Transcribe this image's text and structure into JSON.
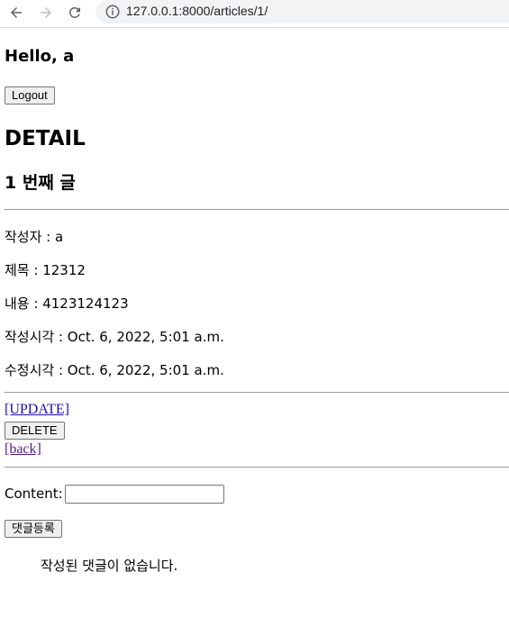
{
  "browser": {
    "url": "127.0.0.1:8000/articles/1/"
  },
  "header": {
    "greeting": "Hello, a",
    "logout_label": "Logout"
  },
  "page": {
    "title": "DETAIL",
    "subtitle": "1 번째 글"
  },
  "article": {
    "author_line": "작성자 : a",
    "title_line": "제목 : 12312",
    "content_line": "내용 : 4123124123",
    "created_line": "작성시각 : Oct. 6, 2022, 5:01 a.m.",
    "updated_line": "수정시각 : Oct. 6, 2022, 5:01 a.m."
  },
  "actions": {
    "update_label": "[UPDATE]",
    "delete_label": "DELETE",
    "back_label": "[back]"
  },
  "comment_form": {
    "content_label": "Content:",
    "content_value": "",
    "submit_label": "댓글등록"
  },
  "comments": {
    "empty_message": "작성된 댓글이 없습니다."
  }
}
